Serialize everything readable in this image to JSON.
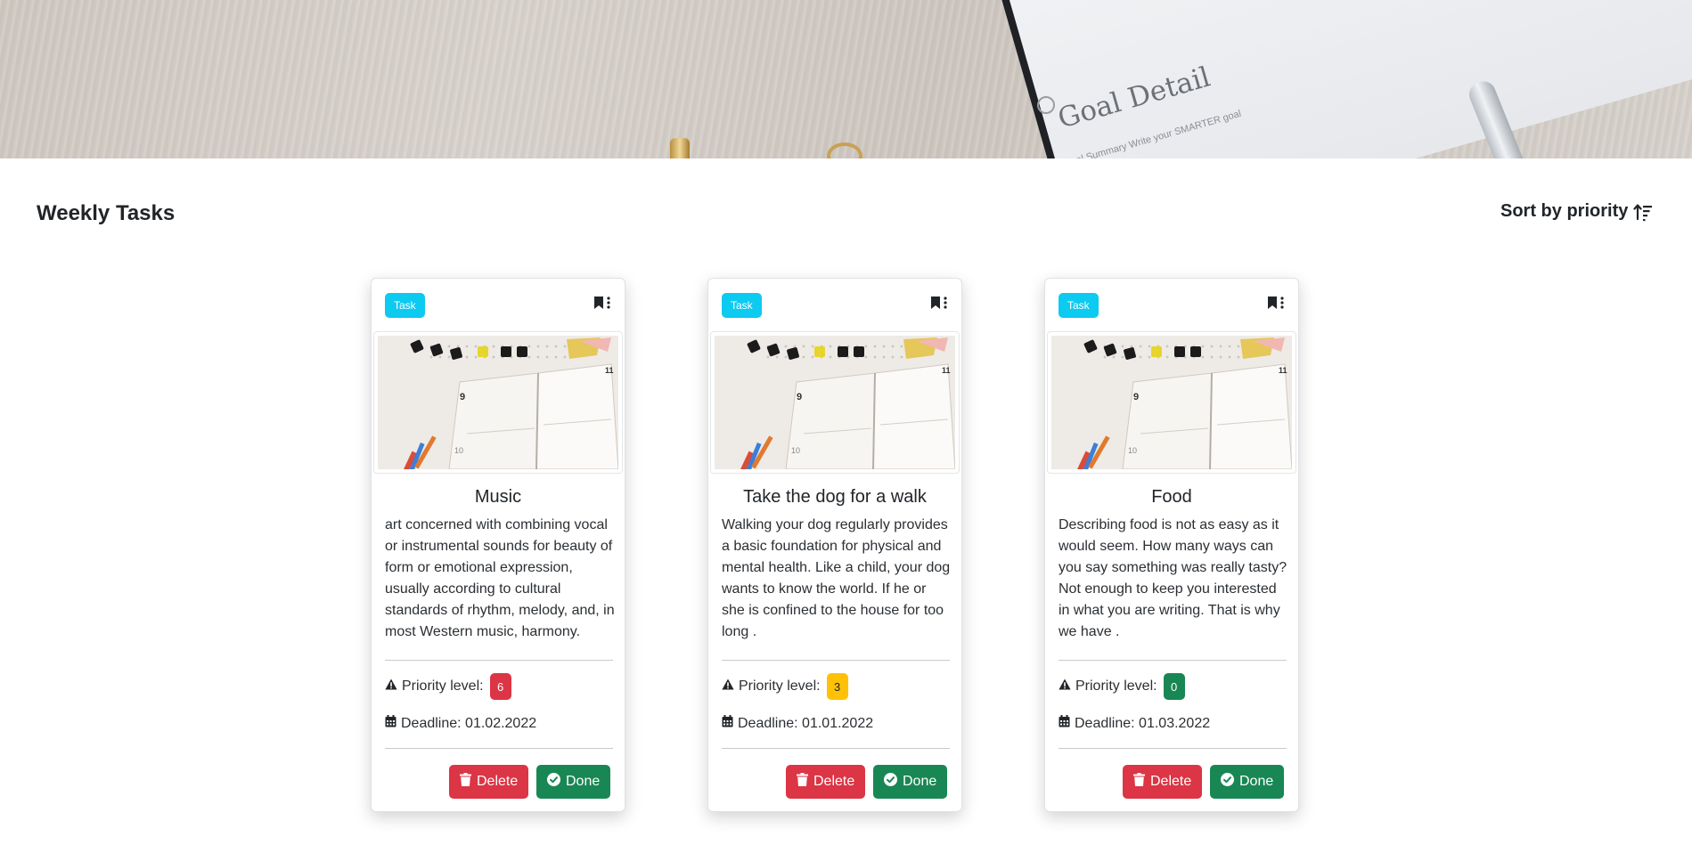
{
  "hero": {
    "notebook_title": "Goal Detail",
    "notebook_subtitle": "Goal Summary   Write your SMARTER goal"
  },
  "header": {
    "title": "Weekly Tasks",
    "sort_label": "Sort by priority"
  },
  "colors": {
    "task_badge": "#0dcaf0",
    "priority_high": "#dc3545",
    "priority_medium": "#ffc107",
    "priority_low": "#198754",
    "delete": "#dc3545",
    "done": "#198754"
  },
  "cards": [
    {
      "badge": "Task",
      "title": "Music",
      "description": "art concerned with combining vocal or instrumental sounds for beauty of form or emotional expression, usually according to cultural standards of rhythm, melody, and, in most Western music, harmony.",
      "priority_label": "Priority level:",
      "priority_value": "6",
      "priority_color": "#dc3545",
      "priority_text_color": "#ffffff",
      "deadline": "Deadline: 01.02.2022",
      "delete_label": "Delete",
      "done_label": "Done"
    },
    {
      "badge": "Task",
      "title": "Take the dog for a walk",
      "description": "Walking your dog regularly provides a basic foundation for physical and mental health. Like a child, your dog wants to know the world. If he or she is confined to the house for too long .",
      "priority_label": "Priority level:",
      "priority_value": "3",
      "priority_color": "#ffc107",
      "priority_text_color": "#212529",
      "deadline": "Deadline: 01.01.2022",
      "delete_label": "Delete",
      "done_label": "Done"
    },
    {
      "badge": "Task",
      "title": "Food",
      "description": "Describing food is not as easy as it would seem. How many ways can you say something was really tasty? Not enough to keep you interested in what you are writing. That is why we have .",
      "priority_label": "Priority level:",
      "priority_value": "0",
      "priority_color": "#198754",
      "priority_text_color": "#ffffff",
      "deadline": "Deadline: 01.03.2022",
      "delete_label": "Delete",
      "done_label": "Done"
    }
  ]
}
